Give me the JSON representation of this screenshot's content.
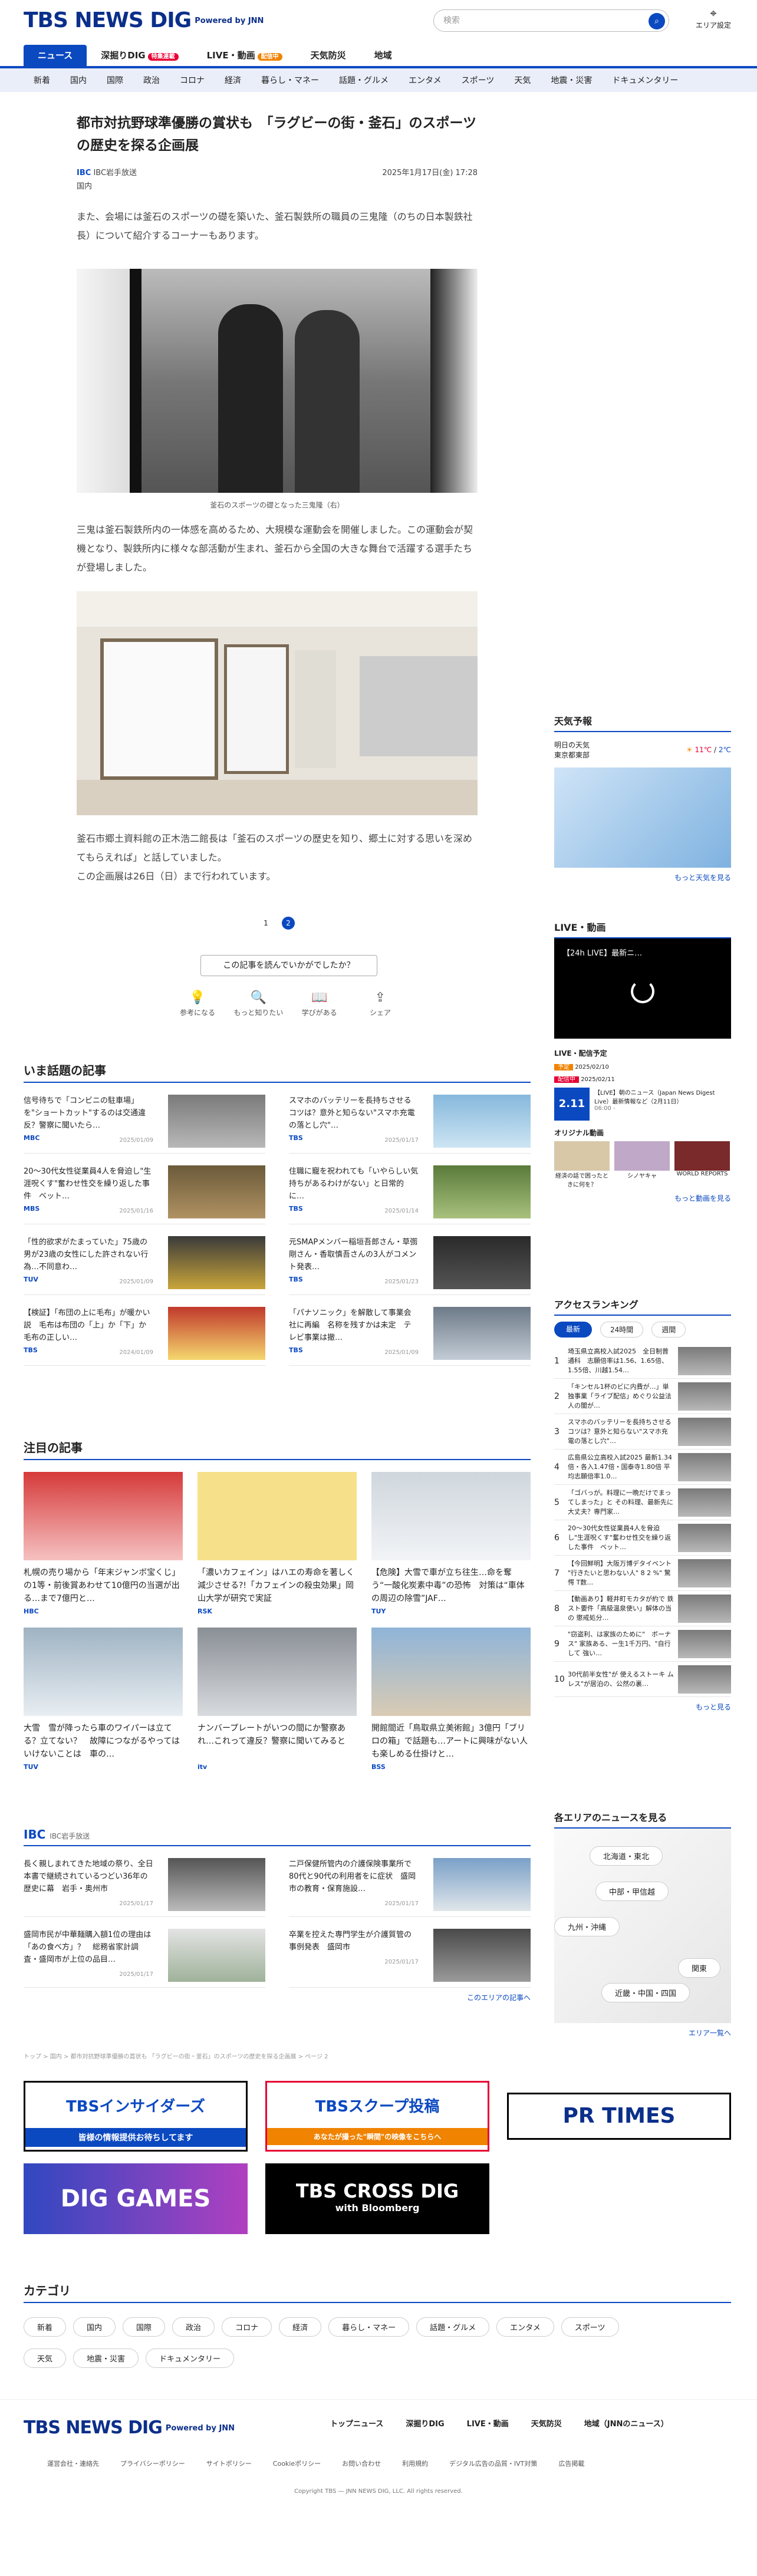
{
  "header": {
    "logo": "TBS NEWS DIG",
    "powered": "Powered by JNN",
    "search_placeholder": "検索",
    "area_setting": "エリア設定"
  },
  "nav_primary": [
    {
      "label": "ニュース"
    },
    {
      "label": "深掘りDIG",
      "badge": "特集連載"
    },
    {
      "label": "LIVE・動画",
      "badge": "配信中"
    },
    {
      "label": "天気防災"
    },
    {
      "label": "地域"
    }
  ],
  "nav_secondary": [
    "新着",
    "国内",
    "国際",
    "政治",
    "コロナ",
    "経済",
    "暮らし・マネー",
    "話題・グルメ",
    "エンタメ",
    "スポーツ",
    "天気",
    "地震・災害",
    "ドキュメンタリー"
  ],
  "article": {
    "title": "都市対抗野球準優勝の賞状も　「ラグビーの街・釜石」のスポーツの歴史を探る企画展",
    "source": "IBC岩手放送",
    "date": "2025年1月17日(金) 17:28",
    "category": "国内",
    "p1": "また、会場には釜石のスポーツの礎を築いた、釜石製鉄所の職員の三鬼隆（のちの日本製鉄社長）について紹介するコーナーもあります。",
    "photo1_caption": "釜石のスポーツの礎となった三鬼隆（右）",
    "p2": "三鬼は釜石製鉄所内の一体感を高めるため、大規模な運動会を開催しました。この運動会が契機となり、製鉄所内に様々な部活動が生まれ、釜石から全国の大きな舞台で活躍する選手たちが登場しました。",
    "p3": "釜石市郷土資料館の正木浩二館長は「釜石のスポーツの歴史を知り、郷土に対する思いを深めてもらえれば」と話していました。",
    "p4": "この企画展は26日（日）まで行われています。",
    "pages": [
      "1",
      "2"
    ],
    "feedback": "この記事を読んでいかがでしたか？",
    "reactions": [
      "参考になる",
      "もっと知りたい",
      "学びがある",
      "シェア"
    ]
  },
  "trending": {
    "heading": "いま話題の記事",
    "items": [
      {
        "title": "信号待ちで「コンビニの駐車場」を\"ショートカット\"するのは交通違反？警察に聞いたら…",
        "src": "MBC",
        "date": "2025/01/09"
      },
      {
        "title": "スマホのバッテリーを長持ちさせるコツは？意外と知らない\"スマホ充電の落とし穴\"…",
        "src": "TBS",
        "date": "2025/01/17"
      },
      {
        "title": "20〜30代女性従業員4人を脅迫し\"生涯呪くす\"奮わせ性交を繰り返した事件　ベット…",
        "src": "MBS",
        "date": "2025/01/16"
      },
      {
        "title": "住職に寵を祝われても「いやらしい気持ちがあるわけがない」と日常的に…",
        "src": "TBS",
        "date": "2025/01/14"
      },
      {
        "title": "「性的欲求がたまっていた」75歳の男が23歳の女性にした許されない行為…不同意わ…",
        "src": "TUV",
        "date": "2025/01/09"
      },
      {
        "title": "元SMAPメンバー稲垣吾郎さん・草彅剛さん・香取慎吾さんの3人がコメント発表…",
        "src": "TBS",
        "date": "2025/01/23"
      },
      {
        "title": "【検証】「布団の上に毛布」が暖かい説　毛布は布団の「上」か「下」か　毛布の正しい…",
        "src": "TBS",
        "date": "2024/01/09"
      },
      {
        "title": "「パナソニック」を解散して事業会社に再編　名称を残すかは未定　テレビ事業は撤…",
        "src": "TBS",
        "date": "2025/01/09"
      }
    ]
  },
  "featured": {
    "heading": "注目の記事",
    "items": [
      {
        "title": "札幌の売り場から「年末ジャンボ宝くじ」の1等・前後賞あわせて10億円の当選が出る…まで7億円と…",
        "src": "HBC",
        "date": "2025/01/17"
      },
      {
        "title": "「濃いカフェイン」はハエの寿命を著しく減少させる?!「カフェインの殺虫効果」岡山大学が研究で実証",
        "src": "RSK",
        "date": "2025/01/17"
      },
      {
        "title": "【危険】大雪で車が立ち往生…命を奪う“一酸化炭素中毒”の恐怖　対策は“車体の周辺の除雪”JAF…",
        "src": "TUY",
        "date": "2025/01/16"
      },
      {
        "title": "大雪　雪が降ったら車のワイパーは立てる？立てない？　故障につながるやってはいけないことは　車の…",
        "src": "TUV",
        "date": "2025/01/10"
      },
      {
        "title": "ナンバープレートがいつの間にか警察あれ…これって違反？警察に聞いてみると",
        "src": "itv",
        "date": "2025/01/08"
      },
      {
        "title": "開館間近「鳥取県立美術館」3億円「ブリロの箱」で話題も…アートに興味がない人も楽しめる仕掛けと…",
        "src": "BSS",
        "date": "2025/01/16"
      }
    ]
  },
  "local": {
    "heading": "IBC岩手放送",
    "items": [
      {
        "title": "長く親しまれてきた地域の祭り、全日本書で継続されているつどい36年の歴史に幕　岩手・奥州市",
        "date": "2025/01/17"
      },
      {
        "title": "二戸保健所管内の介護保険事業所で80代と90代の利用者をに症状　盛岡市の教育・保育施設…",
        "date": "2025/01/17"
      },
      {
        "title": "盛岡市民が中華麺購入額1位の理由は「あの食べ方」？　総務省家計調査・盛岡市が上位の品目…",
        "date": "2025/01/17"
      },
      {
        "title": "卒業を控えた専門学生が介護質管の事例発表　盛岡市",
        "date": "2025/01/17"
      }
    ],
    "more": "このエリアの記事へ"
  },
  "breadcrumb": "トップ > 国内 > 都市対抗野球準優勝の賞状も 「ラグビーの街・釜石」のスポーツの歴史を探る企画展 > ページ 2",
  "sidebar": {
    "weather": {
      "heading": "天気予報",
      "day": "明日の天気",
      "region": "東京都東部",
      "high": "11℃",
      "low": "2℃",
      "more": "もっと天気を見る"
    },
    "live": {
      "heading": "LIVE・動画",
      "video_title": "【24h LIVE】最新ニ…",
      "schedule_heading": "LIVE・配信予定",
      "schedule": [
        {
          "tag": "予定",
          "date": "2025/02/10"
        },
        {
          "tag": "配信中",
          "date": "2025/02/11"
        }
      ],
      "event": {
        "date": "2.11",
        "title": "【LIVE】朝のニュース（Japan News Digest Live）最新情報など（2月11日）",
        "time": "06:00 -"
      },
      "original_heading": "オリジナル動画",
      "originals": [
        "経済の話で困ったときに何を？",
        "シノヤキャ",
        "WORLD REPORTS"
      ],
      "more": "もっと動画を見る"
    },
    "ranking": {
      "heading": "アクセスランキング",
      "tabs": [
        "最新",
        "24時間",
        "週間"
      ],
      "items": [
        "埼玉県立高校入試2025　全日制普通科　志願倍率は1.56、1.65倍、1.55倍、川越1.54…",
        "「キンセル1杯のビに内費が…」単独事業「ライブ配信」めぐり公益法人の闇が…",
        "スマホのバッテリーを長持ちさせるコツは？意外と知らない\"スマホ充電の落とし穴\"…",
        "広島県公立高校入試2025 最新1.34倍・各入1.47倍・国泰寺1.80倍 平均志願倍率1.0…",
        "「ゴバっが。料理に一晩だけでまってしまった」と その料理、最新先に大丈夫？専門家…",
        "20〜30代女性従業員4人を脅迫し\"生涯呪くす\"奮わせ性交を繰り返した事件　ベット…",
        "【今回鮮明】大阪万博デタイベント \"行きたいと思わない人\" 8 2 %\" 驚愕 T数…",
        "【動画あり】軽井町モカタが約で 鉄スト要件「高級温泉使い」解体の当の 懲戒処分…",
        "\"窃盗利、は家族のために\"　ボーナス\" 家族ある、ー生1千万円、\"自行して 強い…",
        "30代前半女性\"が 使えるストーキ ムレス\"が居泊の、公然の裏…"
      ],
      "more": "もっと見る"
    },
    "areas": {
      "heading": "各エリアのニュースを見る",
      "buttons": [
        "北海道・東北",
        "中部・甲信越",
        "九州・沖縄",
        "関東",
        "近畿・中国・四国"
      ],
      "more": "エリア一覧へ"
    }
  },
  "banners": [
    "TBSインサイダーズ",
    "皆様の情報提供お待ちしてます",
    "TBSスクープ投稿",
    "あなたが撮った\"瞬間\"の映像をこちらへ",
    "PR TIMES",
    "DIG GAMES",
    "TBS CROSS DIG",
    "with Bloomberg"
  ],
  "categories": {
    "heading": "カテゴリ",
    "items": [
      "新着",
      "国内",
      "国際",
      "政治",
      "コロナ",
      "経済",
      "暮らし・マネー",
      "話題・グルメ",
      "エンタメ",
      "スポーツ",
      "天気",
      "地震・災害",
      "ドキュメンタリー"
    ]
  },
  "footer": {
    "nav": [
      "トップニュース",
      "深掘りDIG",
      "LIVE・動画",
      "天気防災",
      "地域（JNNのニュース）"
    ],
    "links": [
      "運営会社・連絡先",
      "プライバシーポリシー",
      "サイトポリシー",
      "Cookieポリシー",
      "お問い合わせ",
      "利用規約",
      "デジタル広告の品質・IVT対策",
      "広告掲載"
    ],
    "copyright": "Copyright TBS ― JNN NEWS DIG, LLC. All rights reserved."
  },
  "colors": {
    "brand": "#0b2f8a",
    "accent": "#0b49c1",
    "badge_red": "#e60033",
    "badge_orange": "#f08300"
  }
}
